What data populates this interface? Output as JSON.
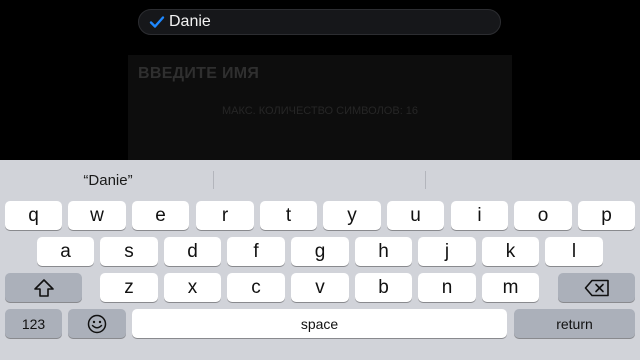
{
  "input": {
    "value": "Danie"
  },
  "dialog": {
    "title": "ВВЕДИТЕ ИМЯ",
    "hint": "МАКС. КОЛИЧЕСТВО СИМВОЛОВ: 16"
  },
  "keyboard": {
    "suggestions": [
      "“Danie”",
      "",
      ""
    ],
    "row1": [
      "q",
      "w",
      "e",
      "r",
      "t",
      "y",
      "u",
      "i",
      "o",
      "p"
    ],
    "row2": [
      "a",
      "s",
      "d",
      "f",
      "g",
      "h",
      "j",
      "k",
      "l"
    ],
    "row3": [
      "z",
      "x",
      "c",
      "v",
      "b",
      "n",
      "m"
    ],
    "numbers_label": "123",
    "space_label": "space",
    "return_label": "return",
    "icons": {
      "shift": "shift-icon",
      "backspace": "backspace-icon",
      "emoji": "emoji-icon"
    }
  },
  "colors": {
    "check": "#1e88ff",
    "keyboard_bg": "#d1d3d9",
    "key_dark": "#abb0ba"
  }
}
